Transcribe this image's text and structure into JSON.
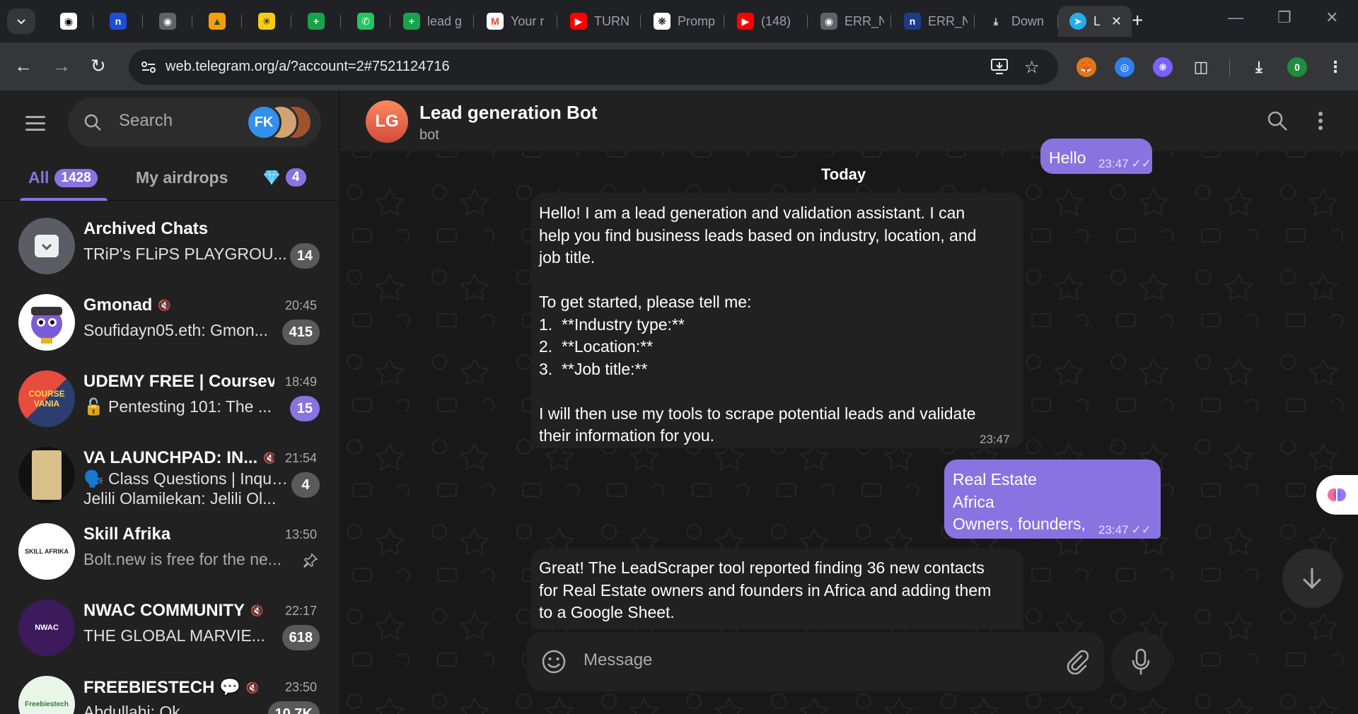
{
  "browser": {
    "tabs": [
      {
        "icon": "github-icon",
        "label": ""
      },
      {
        "icon": "notion-n-icon",
        "label": ""
      },
      {
        "icon": "globe-icon",
        "label": ""
      },
      {
        "icon": "vercel-v-icon",
        "label": ""
      },
      {
        "icon": "asterisk-icon",
        "label": ""
      },
      {
        "icon": "sheets-icon",
        "label": ""
      },
      {
        "icon": "whatsapp-icon",
        "label": ""
      },
      {
        "icon": "sheets-icon",
        "label": "lead g"
      },
      {
        "icon": "gmail-icon",
        "label": "Your r"
      },
      {
        "icon": "youtube-icon",
        "label": "TURN"
      },
      {
        "icon": "openai-icon",
        "label": "Promp"
      },
      {
        "icon": "youtube-icon",
        "label": "(148)"
      },
      {
        "icon": "globe-icon",
        "label": "ERR_N"
      },
      {
        "icon": "n8n-icon",
        "label": "ERR_N"
      },
      {
        "icon": "download-icon",
        "label": "Down"
      }
    ],
    "active_tab_label": "L",
    "url": "web.telegram.org/a/?account=2#7521124716",
    "profile_badge": "0",
    "colors": {
      "chrome_bg": "#202124",
      "toolbar_bg": "#35363a",
      "accent": "#8774e1"
    }
  },
  "sidebar": {
    "search_placeholder": "Search",
    "stack_avatar_label": "FK",
    "folders": [
      {
        "label": "All",
        "badge": "1428"
      },
      {
        "label": "My airdrops",
        "badge": ""
      },
      {
        "label": "",
        "badge": "4",
        "icon": "diamond-icon"
      }
    ],
    "chats": [
      {
        "name": "Archived Chats",
        "time": "",
        "preview": "TRiP's FLiPS PLAYGROU...",
        "preview2": "",
        "badge": "14",
        "muted": false,
        "pinned": false,
        "hot": false
      },
      {
        "name": "Gmonad",
        "time": "20:45",
        "preview": "Soufidayn05.eth: Gmon...",
        "preview2": "",
        "badge": "415",
        "muted": true,
        "pinned": false,
        "hot": false
      },
      {
        "name": "UDEMY FREE | Coursev...",
        "time": "18:49",
        "preview": "🔓 Pentesting 101: The ...",
        "preview2": "",
        "badge": "15",
        "muted": false,
        "pinned": false,
        "hot": true
      },
      {
        "name": "VA LAUNCHPAD: IN...",
        "time": "21:54",
        "preview": "🗣️ Class Questions | Inqui...",
        "preview2": "Jelili Olamilekan: Jelili Ol...",
        "badge": "4",
        "muted": true,
        "pinned": false,
        "hot": false
      },
      {
        "name": "Skill Afrika",
        "time": "13:50",
        "preview": "Bolt.new is free for the ne...",
        "preview2": "",
        "badge": "",
        "muted": false,
        "pinned": true,
        "hot": false
      },
      {
        "name": "NWAC COMMUNITY",
        "time": "22:17",
        "preview": "THE GLOBAL MARVIE...",
        "preview2": "",
        "badge": "618",
        "muted": true,
        "pinned": false,
        "hot": false
      },
      {
        "name": "FREEBIESTECH 💬",
        "time": "23:50",
        "preview": "Abdullahi: Ok",
        "preview2": "",
        "badge": "10.7K",
        "muted": true,
        "pinned": false,
        "hot": false
      }
    ],
    "avatar_text": {
      "nwac": "NWAC",
      "course": "COURSE VANIA",
      "skill": "SKILL AFRIKA",
      "freebies": "Freebiestech"
    }
  },
  "chat": {
    "avatar": "LG",
    "title": "Lead generation Bot",
    "subtitle": "bot",
    "date_label": "Today",
    "messages": [
      {
        "dir": "out",
        "text": "Hello",
        "time": "23:47"
      },
      {
        "dir": "in",
        "text": "Hello! I am a lead generation and validation assistant. I can\nhelp you find business leads based on industry, location, and\njob title.\n\nTo get started, please tell me:\n1.  **Industry type:**\n2.  **Location:**\n3.  **Job title:**\n\nI will then use my tools to scrape potential leads and validate\ntheir information for you.",
        "time": "23:47"
      },
      {
        "dir": "out",
        "text": "Real Estate\nAfrica\nOwners, founders,",
        "time": "23:47"
      },
      {
        "dir": "in",
        "text": "Great! The LeadScraper tool reported finding 36 new contacts\nfor Real Estate owners and founders in Africa and adding them\nto a Google Sheet.",
        "time": ""
      }
    ],
    "composer_placeholder": "Message"
  }
}
